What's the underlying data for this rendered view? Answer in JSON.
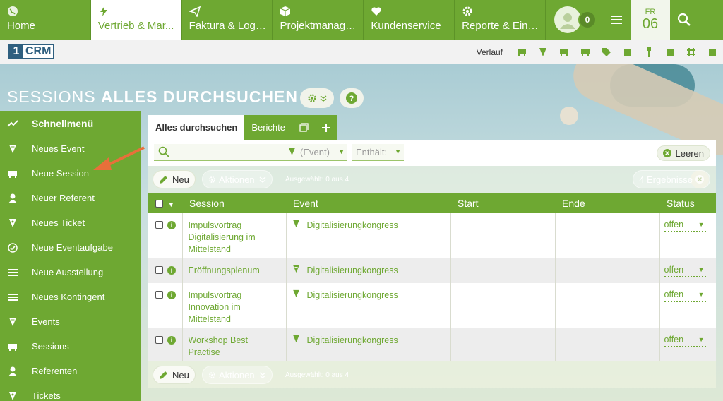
{
  "nav": {
    "tabs": [
      {
        "label": "Home",
        "icon": "globe-icon"
      },
      {
        "label": "Vertrieb & Mar...",
        "icon": "bolt-icon"
      },
      {
        "label": "Faktura & Logis...",
        "icon": "paper-plane-icon"
      },
      {
        "label": "Projektmanage...",
        "icon": "box-icon"
      },
      {
        "label": "Kundenservice",
        "icon": "heart-icon"
      },
      {
        "label": "Reporte & Eins...",
        "icon": "gear-icon"
      }
    ],
    "notification_count": "0",
    "date_day": "FR",
    "date_num": "06"
  },
  "subbar": {
    "logo_one": "1",
    "logo_crm": "CRM",
    "history_label": "Verlauf"
  },
  "page": {
    "title_light": "SESSIONS",
    "title_bold": "ALLES DURCHSUCHEN"
  },
  "sidebar": {
    "header": "Schnellmenü",
    "items": [
      {
        "label": "Neues Event",
        "icon": "event-icon"
      },
      {
        "label": "Neue Session",
        "icon": "session-icon"
      },
      {
        "label": "Neuer Referent",
        "icon": "person-icon"
      },
      {
        "label": "Neues Ticket",
        "icon": "ticket-icon"
      },
      {
        "label": "Neue Eventaufgabe",
        "icon": "check-circle-icon"
      },
      {
        "label": "Neue Ausstellung",
        "icon": "list-icon"
      },
      {
        "label": "Neues Kontingent",
        "icon": "list-icon"
      },
      {
        "label": "Events",
        "icon": "event-icon"
      },
      {
        "label": "Sessions",
        "icon": "session-icon"
      },
      {
        "label": "Referenten",
        "icon": "person-icon"
      },
      {
        "label": "Tickets",
        "icon": "ticket-icon"
      }
    ]
  },
  "tabs": {
    "search_all": "Alles durchsuchen",
    "reports": "Berichte"
  },
  "filter": {
    "event_placeholder": "(Event)",
    "contains_placeholder": "Enthält:",
    "clear_label": "Leeren"
  },
  "actions": {
    "new_label": "Neu",
    "actions_label": "Aktionen",
    "selected_info": "Ausgewählt: 0 aus 4",
    "results_label": "4 Ergebnisse"
  },
  "table": {
    "columns": [
      "Session",
      "Event",
      "Start",
      "Ende",
      "Status"
    ],
    "rows": [
      {
        "session": "Impulsvortrag Digitalisierung im Mittelstand",
        "event": "Digitalisierungkongress",
        "start": "",
        "end": "",
        "status": "offen"
      },
      {
        "session": "Eröffnungsplenum",
        "event": "Digitalisierungkongress",
        "start": "",
        "end": "",
        "status": "offen"
      },
      {
        "session": "Impulsvortrag Innovation im Mittelstand",
        "event": "Digitalisierungkongress",
        "start": "",
        "end": "",
        "status": "offen"
      },
      {
        "session": "Workshop Best Practise",
        "event": "Digitalisierungkongress",
        "start": "",
        "end": "",
        "status": "offen"
      }
    ]
  },
  "colors": {
    "brand_green": "#6ea832",
    "arrow_orange": "#e8703a"
  }
}
